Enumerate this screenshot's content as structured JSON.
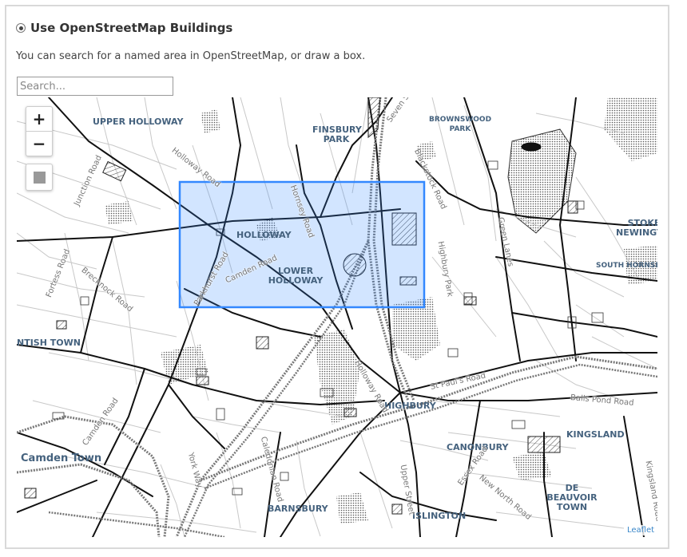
{
  "section": {
    "radio_label": "Use OpenStreetMap Buildings",
    "description": "You can search for a named area in OpenStreetMap, or draw a box."
  },
  "search": {
    "placeholder": "Search...",
    "value": ""
  },
  "map": {
    "zoom_in": "+",
    "zoom_out": "−",
    "attribution": "Leaflet",
    "area_labels": [
      "UPPER HOLLOWAY",
      "FINSBURY PARK",
      "BROWNSWOOD PARK",
      "HOLLOWAY",
      "LOWER HOLLOWAY",
      "STOKE NEWINGTON",
      "SOUTH HORNSEY",
      "NTISH TOWN",
      "HIGHBURY",
      "KINGSLAND",
      "CANONBURY",
      "DE BEAUVOIR TOWN",
      "Camden Town",
      "BARNSBURY",
      "ISLINGTON"
    ],
    "street_labels": [
      "Holloway Road",
      "Junction Road",
      "Hornsey Road",
      "Blackstock Road",
      "Highbury Park",
      "Green Lanes",
      "Camden Road",
      "Hillmarton Road",
      "Brecknock Road",
      "Fortess Road",
      "Holloway Road",
      "St Paul's Road",
      "Balls Pond Road",
      "Camden Road",
      "Caledonian Road",
      "York Way",
      "Upper Street",
      "Essex Road",
      "New North Road",
      "Kingsland Road",
      "Seven Sisters Road",
      "Parkhurst Road"
    ],
    "selection_color": "#3388ff",
    "icons": [
      "zoom-in-icon",
      "zoom-out-icon",
      "draw-rectangle-icon"
    ]
  }
}
